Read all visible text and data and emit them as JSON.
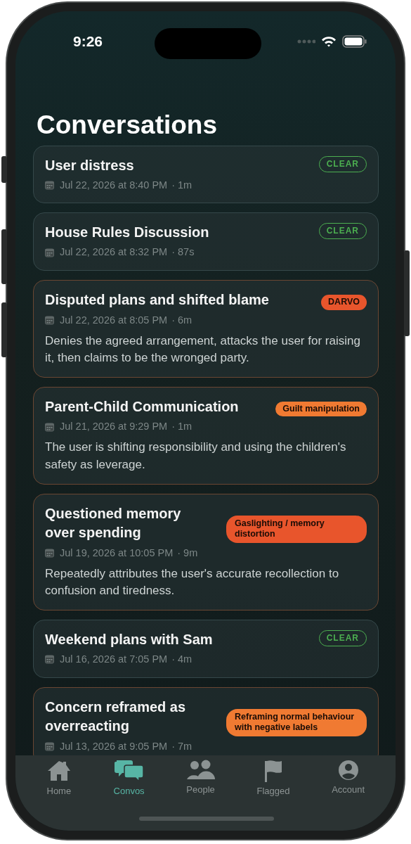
{
  "status_bar": {
    "time": "9:26"
  },
  "title": "Conversations",
  "conversations": [
    {
      "title": "User distress",
      "date": "Jul 22, 2026 at 8:40 PM",
      "duration": "· 1m",
      "tag": {
        "label": "CLEAR",
        "kind": "clear",
        "color": "#4caf50"
      }
    },
    {
      "title": "House Rules Discussion",
      "date": "Jul 22, 2026 at 8:32 PM",
      "duration": "· 87s",
      "tag": {
        "label": "CLEAR",
        "kind": "clear",
        "color": "#4caf50"
      }
    },
    {
      "title": "Disputed plans and shifted blame",
      "date": "Jul 22, 2026 at 8:05 PM",
      "duration": "· 6m",
      "summary": "Denies the agreed arrangement, attacks the user for raising it, then claims to be the wronged party.",
      "tag": {
        "label": "DARVO",
        "kind": "flag",
        "color": "#e8552c"
      }
    },
    {
      "title": "Parent-Child Communication",
      "date": "Jul 21, 2026 at 9:29 PM",
      "duration": "· 1m",
      "summary": "The user is shifting responsibility and using the children's safety as leverage.",
      "tag": {
        "label": "Guilt manipulation",
        "kind": "flag",
        "color": "#f07a32"
      }
    },
    {
      "title": "Questioned memory over spending",
      "date": "Jul 19, 2026 at 10:05 PM",
      "duration": "· 9m",
      "summary": "Repeatedly attributes the user's accurate recollection to confusion and tiredness.",
      "tag": {
        "label": "Gaslighting / memory distortion",
        "kind": "flag",
        "color": "#e8552c"
      }
    },
    {
      "title": "Weekend plans with Sam",
      "date": "Jul 16, 2026 at 7:05 PM",
      "duration": "· 4m",
      "tag": {
        "label": "CLEAR",
        "kind": "clear",
        "color": "#4caf50"
      }
    },
    {
      "title": "Concern reframed as overreacting",
      "date": "Jul 13, 2026 at 9:05 PM",
      "duration": "· 7m",
      "tag": {
        "label": "Reframing normal behaviour with negative labels",
        "kind": "flag",
        "color": "#f07a32"
      }
    }
  ],
  "tab_bar": [
    {
      "label": "Home",
      "kind": "home",
      "selected": false
    },
    {
      "label": "Convos",
      "kind": "chat",
      "selected": true
    },
    {
      "label": "People",
      "kind": "people",
      "selected": false
    },
    {
      "label": "Flagged",
      "kind": "flag",
      "selected": false
    },
    {
      "label": "Account",
      "kind": "account",
      "selected": false
    }
  ]
}
